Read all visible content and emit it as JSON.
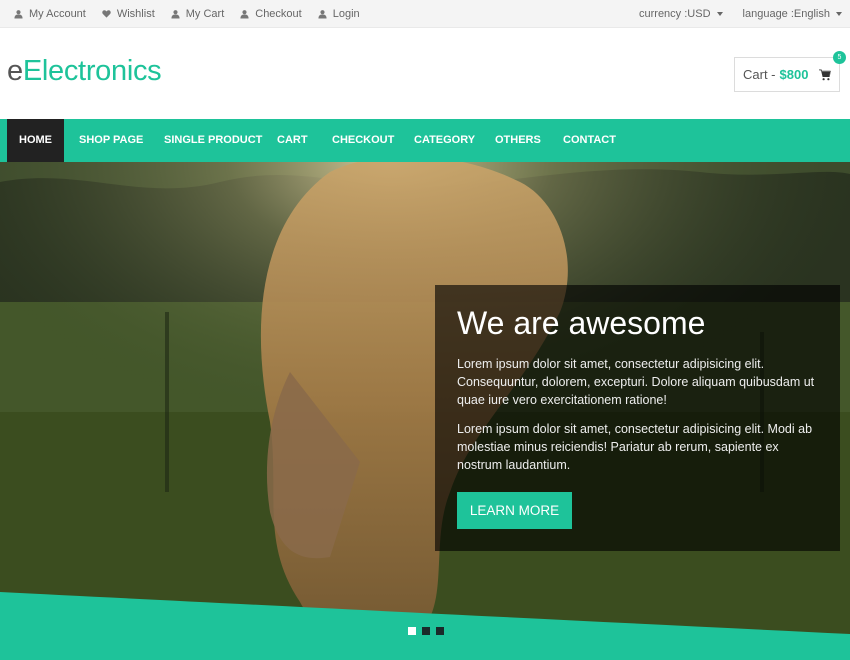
{
  "topbar": {
    "links": [
      {
        "label": "My Account",
        "icon": "user-icon"
      },
      {
        "label": "Wishlist",
        "icon": "heart-icon"
      },
      {
        "label": "My Cart",
        "icon": "user-icon"
      },
      {
        "label": "Checkout",
        "icon": "user-icon"
      },
      {
        "label": "Login",
        "icon": "user-icon"
      }
    ],
    "currency": "currency :USD",
    "language": "language :English"
  },
  "header": {
    "logo_prefix": "e",
    "logo_rest": "Electronics",
    "cart_label": "Cart -",
    "cart_amount": "$800",
    "cart_count": "5"
  },
  "nav": {
    "items": [
      "HOME",
      "SHOP PAGE",
      "SINGLE PRODUCT",
      "CART",
      "CHECKOUT",
      "CATEGORY",
      "OTHERS",
      "CONTACT"
    ]
  },
  "hero": {
    "title": "We are awesome",
    "paragraph1": "Lorem ipsum dolor sit amet, consectetur adipisicing elit. Consequuntur, dolorem, excepturi. Dolore aliquam quibusdam ut quae iure vero exercitationem ratione!",
    "paragraph2": "Lorem ipsum dolor sit amet, consectetur adipisicing elit. Modi ab molestiae minus reiciendis! Pariatur ab rerum, sapiente ex nostrum laudantium.",
    "button_label": "LEARN MORE",
    "slide_count": 3,
    "active_slide": 1
  },
  "colors": {
    "accent": "#1ec39a",
    "nav_active": "#222222"
  }
}
